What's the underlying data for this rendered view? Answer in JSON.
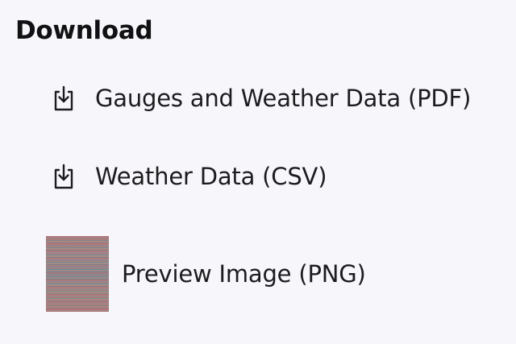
{
  "download": {
    "heading": "Download",
    "items": [
      {
        "label": "Gauges and Weather Data (PDF)",
        "icon": "download-icon"
      },
      {
        "label": "Weather Data (CSV)",
        "icon": "download-icon"
      },
      {
        "label": "Preview Image (PNG)",
        "icon": "image-thumbnail"
      }
    ]
  }
}
